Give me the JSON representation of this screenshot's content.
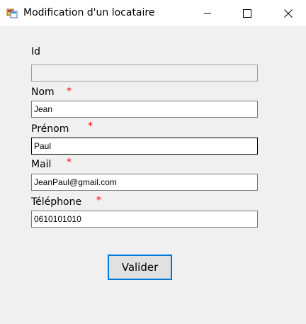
{
  "window": {
    "title": "Modification d'un locataire"
  },
  "form": {
    "id": {
      "label": "Id",
      "value": ""
    },
    "nom": {
      "label": "Nom",
      "required_mark": "*",
      "value": "Jean"
    },
    "prenom": {
      "label": "Prénom",
      "required_mark": "*",
      "value": "Paul"
    },
    "mail": {
      "label": "Mail",
      "required_mark": "*",
      "value": "JeanPaul@gmail.com"
    },
    "telephone": {
      "label": "Téléphone",
      "required_mark": "*",
      "value": "0610101010"
    },
    "submit_label": "Valider"
  },
  "colors": {
    "required": "#ff0000",
    "focus_border": "#0078d7"
  }
}
